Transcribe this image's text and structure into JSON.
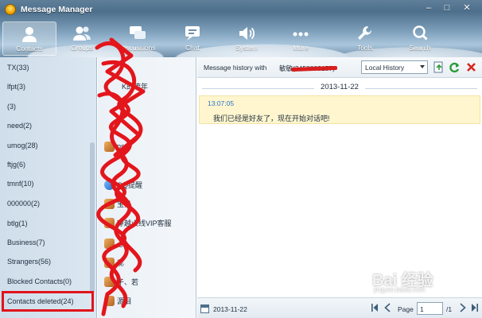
{
  "window": {
    "title": "Message Manager",
    "minimize": "–",
    "maximize": "□",
    "close": "✕"
  },
  "nav": [
    {
      "label": "Contacts",
      "icon": "person-icon",
      "active": true
    },
    {
      "label": "Groups",
      "icon": "group-icon"
    },
    {
      "label": "Discussions",
      "icon": "discussion-icon"
    },
    {
      "label": "Chat",
      "icon": "chat-icon"
    },
    {
      "label": "System",
      "icon": "speaker-icon"
    },
    {
      "label": "More",
      "icon": "more-icon"
    },
    {
      "label": "Tools",
      "icon": "wrench-icon"
    },
    {
      "label": "Search",
      "icon": "search-icon"
    }
  ],
  "left": {
    "items": [
      "TX(33)",
      "lfpt(3)",
      "(3)",
      "need(2)",
      "umog(28)",
      "ftjg(6)",
      "tmnf(10)",
      "000000(2)",
      "btlg(1)",
      "Business(7)",
      "Strangers(56)",
      "Blocked Contacts(0)",
      "Contacts deleted(24)"
    ]
  },
  "middle": {
    "contacts": [
      {
        "name": "K的流年"
      },
      {
        "name": "ps"
      },
      {
        "name": "QQ提醒"
      },
      {
        "name": "宝贝"
      },
      {
        "name": "穿越火线VIP客服"
      },
      {
        "name": "心"
      },
      {
        "name": "蕊"
      },
      {
        "name": "孑、若"
      },
      {
        "name": "源泪"
      }
    ]
  },
  "toolbar": {
    "history_label": "Message history with",
    "contact_name": "敏敏(3458883157)",
    "history_source": "Local History"
  },
  "conversation": {
    "date": "2013-11-22",
    "messages": [
      {
        "time": "13:07:05",
        "text": "我们已经是好友了，现在开始对话吧!"
      }
    ]
  },
  "footer": {
    "date": "2013-11-22",
    "page_label": "Page",
    "page_value": "1",
    "page_total": "/1"
  },
  "watermark": {
    "text": "Bai 经验",
    "sub": "jingyan.baidu.com"
  }
}
